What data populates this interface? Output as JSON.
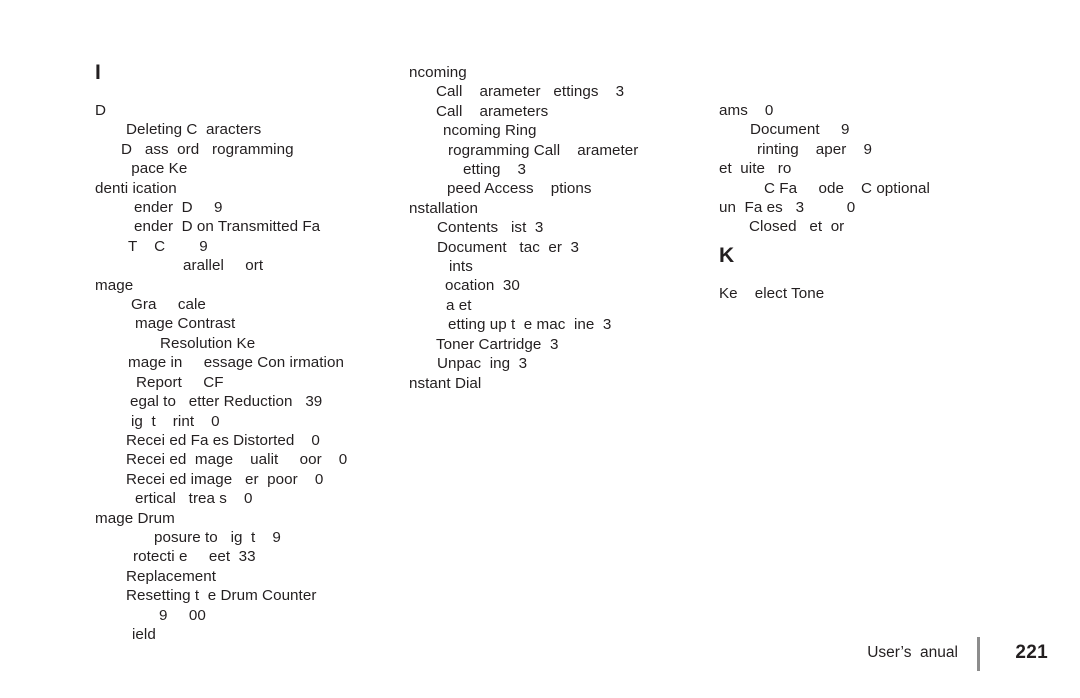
{
  "page": {
    "number": "221",
    "footer_label": "User’s  anual"
  },
  "columns": [
    {
      "id": "col-1",
      "heading": "I",
      "entries": [
        {
          "text": "D",
          "indent": 0
        },
        {
          "text": "Deleting C  aracters",
          "indent": 31
        },
        {
          "text": "D   ass  ord   rogramming",
          "indent": 26
        },
        {
          "text": " pace Ke",
          "indent": 32
        },
        {
          "text": "denti ication",
          "indent": 0
        },
        {
          "text": "ender  D     9",
          "indent": 39
        },
        {
          "text": "ender  D on Transmitted Fa",
          "indent": 39
        },
        {
          "text": "T    C        9",
          "indent": 33
        },
        {
          "text": "arallel     ort",
          "indent": 88
        },
        {
          "text": "mage",
          "indent": 0
        },
        {
          "text": "Gra     cale",
          "indent": 36
        },
        {
          "text": "mage Contrast",
          "indent": 40
        },
        {
          "text": "Resolution Ke",
          "indent": 65
        },
        {
          "text": "mage in     essage Con irmation",
          "indent": 33
        },
        {
          "text": "Report     CF",
          "indent": 41
        },
        {
          "text": "egal to   etter Reduction   39",
          "indent": 35
        },
        {
          "text": "ig  t    rint    0",
          "indent": 36
        },
        {
          "text": "Recei ed Fa es Distorted    0",
          "indent": 31
        },
        {
          "text": "Recei ed  mage    ualit     oor    0",
          "indent": 31
        },
        {
          "text": "Recei ed image   er  poor    0",
          "indent": 31
        },
        {
          "text": "ertical   trea s    0",
          "indent": 40
        },
        {
          "text": "mage Drum",
          "indent": 0
        },
        {
          "text": "posure to   ig  t    9",
          "indent": 59
        },
        {
          "text": "rotecti e     eet  33",
          "indent": 38
        },
        {
          "text": "Replacement",
          "indent": 31
        },
        {
          "text": "Resetting t  e Drum Counter",
          "indent": 31
        },
        {
          "text": "9     00",
          "indent": 64
        },
        {
          "text": "ield",
          "indent": 37
        }
      ]
    },
    {
      "id": "col-2",
      "heading": "",
      "entries": [
        {
          "text": "ncoming",
          "indent": 0
        },
        {
          "text": "Call    arameter   ettings    3",
          "indent": 27
        },
        {
          "text": "Call    arameters",
          "indent": 27
        },
        {
          "text": "ncoming Ring",
          "indent": 34
        },
        {
          "text": "rogramming Call    arameter",
          "indent": 39
        },
        {
          "text": "etting    3",
          "indent": 54
        },
        {
          "text": "peed Access    ptions",
          "indent": 38
        },
        {
          "text": "nstallation",
          "indent": 0
        },
        {
          "text": "Contents   ist  3",
          "indent": 28
        },
        {
          "text": "Document   tac  er  3",
          "indent": 28
        },
        {
          "text": "ints",
          "indent": 40
        },
        {
          "text": "ocation  30",
          "indent": 36
        },
        {
          "text": "a et",
          "indent": 37
        },
        {
          "text": "etting up t  e mac  ine  3",
          "indent": 39
        },
        {
          "text": "Toner Cartridge  3",
          "indent": 27
        },
        {
          "text": "Unpac  ing  3",
          "indent": 28
        },
        {
          "text": "nstant Dial",
          "indent": 0
        }
      ]
    },
    {
      "id": "col-3",
      "heading": "",
      "entries": [
        {
          "text": "ams    0",
          "indent": 0
        },
        {
          "text": "Document     9",
          "indent": 31
        },
        {
          "text": "rinting    aper    9",
          "indent": 38
        },
        {
          "text": "et  uite   ro",
          "indent": 0
        },
        {
          "text": "C Fa     ode    C optional",
          "indent": 45
        },
        {
          "text": "un  Fa es   3          0",
          "indent": 0
        },
        {
          "text": "Closed   et  or",
          "indent": 30
        }
      ]
    }
  ],
  "k_section": {
    "heading": "K",
    "entries": [
      {
        "text": "Ke    elect Tone",
        "indent": 0
      }
    ]
  }
}
